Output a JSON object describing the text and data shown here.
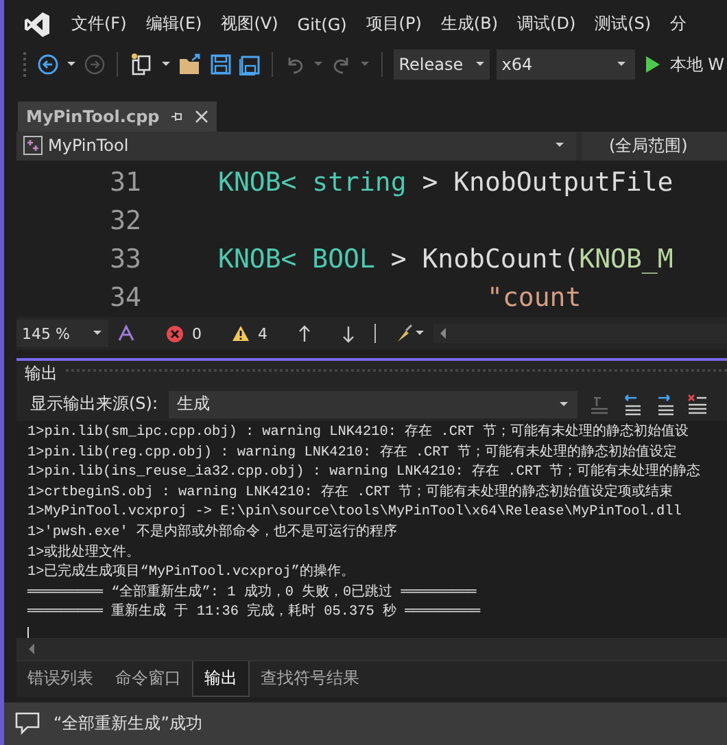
{
  "menu": [
    "文件(F)",
    "编辑(E)",
    "视图(V)",
    "Git(G)",
    "项目(P)",
    "生成(B)",
    "调试(D)",
    "测试(S)",
    "分"
  ],
  "toolbar": {
    "configuration": "Release",
    "platform": "x64",
    "run_label": "本地 W"
  },
  "editor_tab": {
    "label": "MyPinTool.cpp",
    "selected": true
  },
  "nav_bar": {
    "scope": "MyPinTool",
    "member": "(全局范围)"
  },
  "code_lines": [
    {
      "number": "31",
      "tokens": [
        {
          "kind": "type",
          "text": "KNOB<"
        },
        {
          "kind": "type",
          "text": " string"
        },
        {
          "kind": "plain",
          "text": " > KnobOutputFile"
        }
      ]
    },
    {
      "number": "32"
    },
    {
      "number": "33",
      "tokens": [
        {
          "kind": "type",
          "text": "KNOB<"
        },
        {
          "kind": "type",
          "text": " BOOL"
        },
        {
          "kind": "plain",
          "text": " > KnobCount("
        },
        {
          "kind": "macro",
          "text": "KNOB_M"
        }
      ]
    },
    {
      "number": "34",
      "continuation": true,
      "tokens": [
        {
          "kind": "string",
          "text": "\"count"
        }
      ]
    }
  ],
  "editor_status": {
    "zoom": "145 %",
    "errors": "0",
    "warnings": "4"
  },
  "output": {
    "title": "输出",
    "source_label": "显示输出来源(S):",
    "source": "生成",
    "lines": [
      "1>pin.lib(sm_ipc.cpp.obj) : warning LNK4210: 存在 .CRT 节；可能有未处理的静态初始值设",
      "1>pin.lib(reg.cpp.obj) : warning LNK4210: 存在 .CRT 节；可能有未处理的静态初始值设定",
      "1>pin.lib(ins_reuse_ia32.cpp.obj) : warning LNK4210: 存在 .CRT 节；可能有未处理的静态",
      "1>crtbeginS.obj : warning LNK4210: 存在 .CRT 节；可能有未处理的静态初始值设定项或结束",
      "1>MyPinTool.vcxproj -> E:\\pin\\source\\tools\\MyPinTool\\x64\\Release\\MyPinTool.dll",
      "1>'pwsh.exe' 不是内部或外部命令，也不是可运行的程序",
      "1>或批处理文件。",
      "1>已完成生成项目“MyPinTool.vcxproj”的操作。",
      "═════════ “全部重新生成”: 1 成功，0 失败，0已跳过 ═════════",
      "═════════ 重新生成 于 11:36 完成，耗时 05.375 秒 ═════════"
    ]
  },
  "bottom_tabs": [
    {
      "label": "错误列表",
      "selected": false
    },
    {
      "label": "命令窗口",
      "selected": false
    },
    {
      "label": "输出",
      "selected": true
    },
    {
      "label": "查找符号结果",
      "selected": false
    }
  ],
  "status_bar": {
    "message": "“全部重新生成”成功"
  }
}
